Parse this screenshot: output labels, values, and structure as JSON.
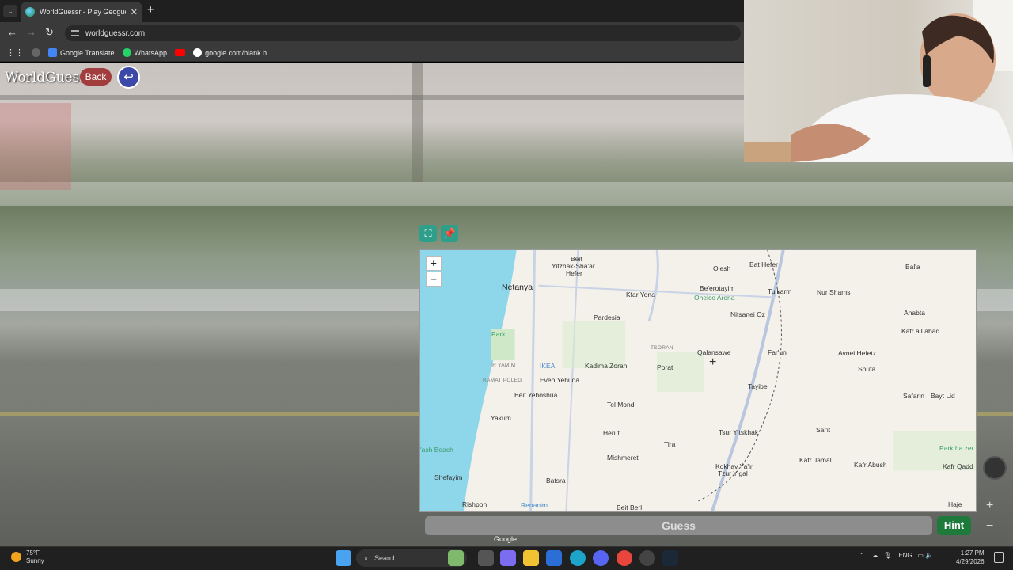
{
  "browser": {
    "tab_title": "WorldGuessr - Play Geoguessr Fre",
    "tab_close": "✕",
    "new_tab": "+",
    "url": "worldguessr.com",
    "bookmarks": [
      {
        "label": "Google Translate",
        "color": "#4285f4"
      },
      {
        "label": "WhatsApp",
        "color": "#25d366"
      },
      {
        "label": "",
        "color": "#ff0000"
      },
      {
        "label": "google.com/blank.h...",
        "color": "#888888"
      }
    ]
  },
  "game": {
    "logo": "WorldGuessr",
    "back_label": "Back",
    "guess_label": "Guess",
    "hint_label": "Hint",
    "google_credit": "Google"
  },
  "map": {
    "zoom_in": "+",
    "zoom_out": "−",
    "labels": [
      {
        "text": "Beit",
        "cls": ""
      },
      {
        "text": "Yitzhak-Sha'ar",
        "cls": ""
      },
      {
        "text": "Hefer",
        "cls": ""
      },
      {
        "text": "Netanya",
        "cls": "big"
      },
      {
        "text": "Kfar Yona",
        "cls": ""
      },
      {
        "text": "Olesh",
        "cls": ""
      },
      {
        "text": "Bat Hefer",
        "cls": ""
      },
      {
        "text": "Be'erotayim",
        "cls": ""
      },
      {
        "text": "Onelce Arena",
        "cls": "poi-green"
      },
      {
        "text": "Tulkarm",
        "cls": ""
      },
      {
        "text": "Nur Shams",
        "cls": ""
      },
      {
        "text": "Bal'a",
        "cls": ""
      },
      {
        "text": "Pardesia",
        "cls": ""
      },
      {
        "text": "Nitsanei Oz",
        "cls": ""
      },
      {
        "text": "Anabta",
        "cls": ""
      },
      {
        "text": "Park",
        "cls": "park"
      },
      {
        "text": "Kafr alLabad",
        "cls": ""
      },
      {
        "text": "TSORAN",
        "cls": "small"
      },
      {
        "text": "Qalansawe",
        "cls": ""
      },
      {
        "text": "Far'un",
        "cls": ""
      },
      {
        "text": "Avnei Hefetz",
        "cls": ""
      },
      {
        "text": "IR YAMIM",
        "cls": "small"
      },
      {
        "text": "IKEA",
        "cls": "poi"
      },
      {
        "text": "Kadima Zoran",
        "cls": ""
      },
      {
        "text": "Porat",
        "cls": ""
      },
      {
        "text": "Shufa",
        "cls": ""
      },
      {
        "text": "RAMAT POLEG",
        "cls": "small"
      },
      {
        "text": "Even Yehuda",
        "cls": ""
      },
      {
        "text": "Tayibe",
        "cls": ""
      },
      {
        "text": "Beit Yehoshua",
        "cls": ""
      },
      {
        "text": "Safarin",
        "cls": ""
      },
      {
        "text": "Bayt Lid",
        "cls": ""
      },
      {
        "text": "Yakum",
        "cls": ""
      },
      {
        "text": "Tel Mond",
        "cls": ""
      },
      {
        "text": "Herut",
        "cls": ""
      },
      {
        "text": "Tsur Yitskhak",
        "cls": ""
      },
      {
        "text": "Sal'it",
        "cls": ""
      },
      {
        "text": "Tira",
        "cls": ""
      },
      {
        "text": "'ash Beach",
        "cls": "poi-green"
      },
      {
        "text": "Park ha zer",
        "cls": "park"
      },
      {
        "text": "Mishmeret",
        "cls": ""
      },
      {
        "text": "Kafr Jamal",
        "cls": ""
      },
      {
        "text": "Kafr Abush",
        "cls": ""
      },
      {
        "text": "Kafr Qadd",
        "cls": ""
      },
      {
        "text": "Kokhav Ya'ir",
        "cls": ""
      },
      {
        "text": "Tzur Yigal",
        "cls": ""
      },
      {
        "text": "Shefayim",
        "cls": ""
      },
      {
        "text": "Batsra",
        "cls": ""
      },
      {
        "text": "Rishpon",
        "cls": ""
      },
      {
        "text": "Renanim",
        "cls": "poi"
      },
      {
        "text": "Beit Berl",
        "cls": ""
      },
      {
        "text": "Haje",
        "cls": ""
      }
    ]
  },
  "taskbar": {
    "weather_temp": "75°F",
    "weather_desc": "Sunny",
    "search_label": "Search",
    "lang": "ENG",
    "time": "1:27 PM",
    "date": "4/29/2026"
  }
}
